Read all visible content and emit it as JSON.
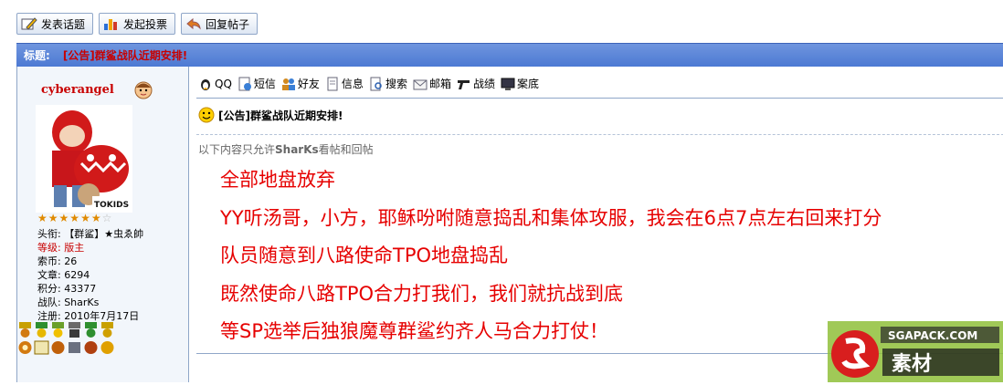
{
  "toolbar": {
    "new_topic": "发表话题",
    "new_poll": "发起投票",
    "reply": "回复帖子"
  },
  "titlebar": {
    "label": "标题:",
    "title": "[公告]群鲨战队近期安排!"
  },
  "user": {
    "name": "cyberangel",
    "stars_filled": 6,
    "stars_total": 7,
    "info": {
      "title": "头衔: 【群鲨】★虫ゑ帥",
      "level": "等级: 版主",
      "coins": "索币: 26",
      "posts": "文章: 6294",
      "points": "积分: 43377",
      "team": "战队: SharKs",
      "registered": "注册: 2010年7月17日"
    }
  },
  "post_icons": {
    "qq": "QQ",
    "sms": "短信",
    "friend": "好友",
    "info": "信息",
    "search": "搜索",
    "mail": "邮箱",
    "battle": "战绩",
    "record": "案底"
  },
  "post": {
    "title": "[公告]群鲨战队近期安排!",
    "permission": "以下内容只允许",
    "permission_group": "SharKs",
    "permission_end": "看帖和回帖",
    "lines": [
      "全部地盘放弃",
      "YY听汤哥，小方，耶稣吩咐随意捣乱和集体攻服，我会在6点7点左右回来打分",
      "队员随意到八路使命TPO地盘捣乱",
      "既然使命八路TPO合力打我们，我们就抗战到底",
      "等SP选举后独狼魔尊群鲨约齐人马合力打仗！"
    ]
  },
  "watermark": {
    "site": "SGAPACK.COM",
    "brand": "素材"
  },
  "colors": {
    "accent_blue": "#4c79d3",
    "red": "#e60000",
    "border": "#8fa6c8"
  }
}
